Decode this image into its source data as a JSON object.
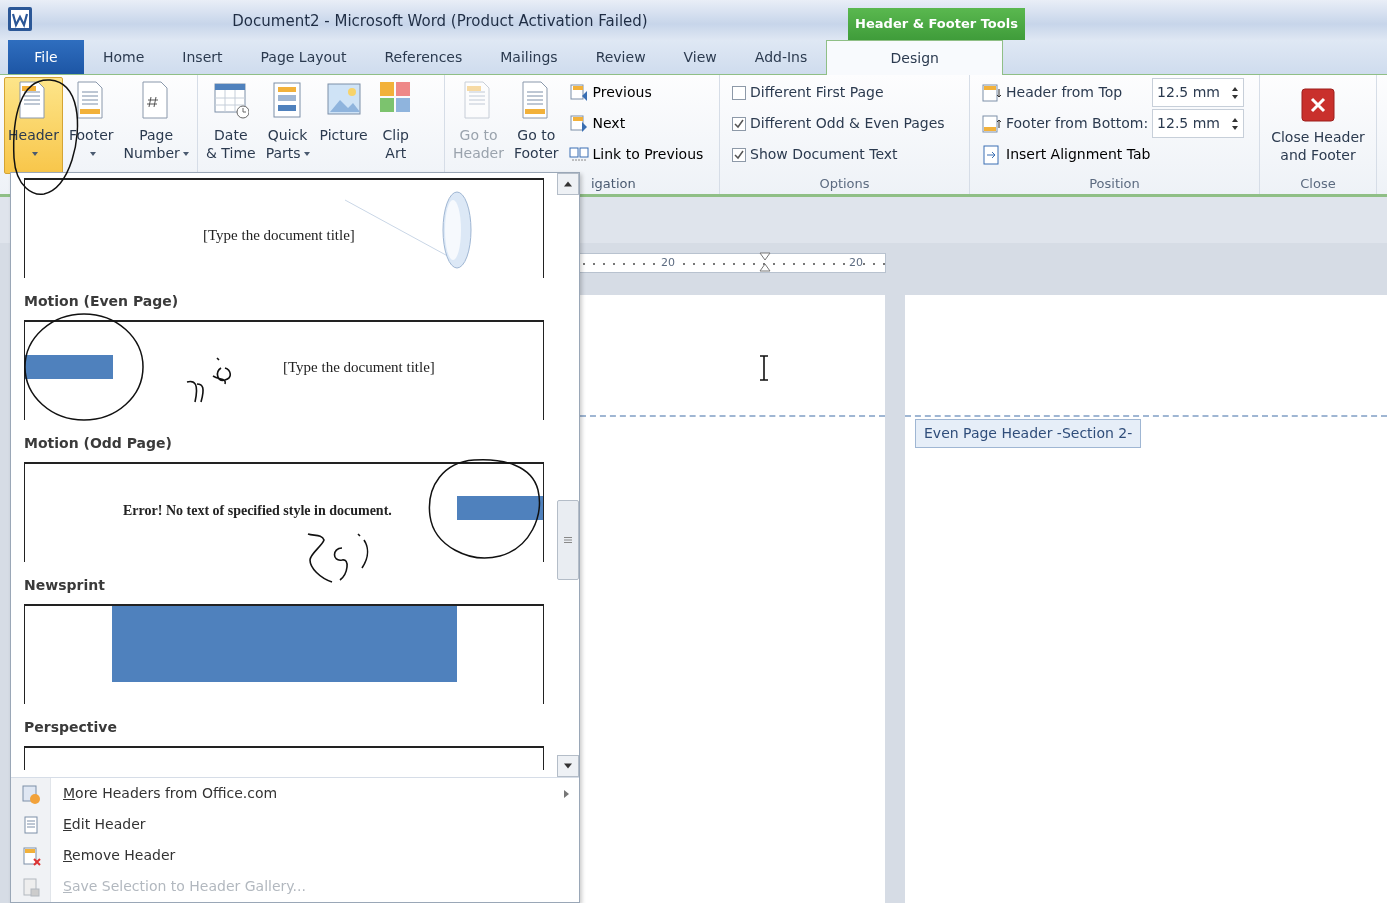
{
  "window": {
    "title": "Document2 - Microsoft Word (Product Activation Failed)",
    "context_title": "Header & Footer Tools"
  },
  "tabs": [
    {
      "label": "File",
      "kind": "file",
      "selected": false
    },
    {
      "label": "Home",
      "kind": "plain",
      "selected": false
    },
    {
      "label": "Insert",
      "kind": "plain",
      "selected": false
    },
    {
      "label": "Page Layout",
      "kind": "plain",
      "selected": false
    },
    {
      "label": "References",
      "kind": "plain",
      "selected": false
    },
    {
      "label": "Mailings",
      "kind": "plain",
      "selected": false
    },
    {
      "label": "Review",
      "kind": "plain",
      "selected": false
    },
    {
      "label": "View",
      "kind": "plain",
      "selected": false
    },
    {
      "label": "Add-Ins",
      "kind": "plain",
      "selected": false
    },
    {
      "label": "Design",
      "kind": "context",
      "selected": true
    }
  ],
  "ribbon": {
    "groups": [
      {
        "kind": "large",
        "controls": [
          {
            "label": "Header",
            "dropdown": true,
            "pressed": true,
            "disabled": false
          },
          {
            "label": "Footer",
            "dropdown": true,
            "pressed": false,
            "disabled": false
          },
          {
            "label": "Page\nNumber",
            "dropdown": true,
            "pressed": false,
            "disabled": false
          }
        ]
      },
      {
        "kind": "large",
        "controls": [
          {
            "label": "Date\n& Time",
            "dropdown": false,
            "pressed": false,
            "disabled": false
          },
          {
            "label": "Quick\nParts",
            "dropdown": true,
            "pressed": false,
            "disabled": false
          },
          {
            "label": "Picture",
            "dropdown": false,
            "pressed": false,
            "disabled": false
          },
          {
            "label": "Clip\nArt",
            "dropdown": false,
            "pressed": false,
            "disabled": false
          }
        ]
      },
      {
        "kind": "nav",
        "label": "igation",
        "controls": [
          {
            "label": "Go to\nHeader",
            "dropdown": false,
            "pressed": false,
            "disabled": true
          },
          {
            "label": "Go to\nFooter",
            "dropdown": false,
            "pressed": false,
            "disabled": false
          }
        ],
        "small": [
          {
            "label": "Previous"
          },
          {
            "label": "Next"
          },
          {
            "label": "Link to Previous"
          }
        ]
      },
      {
        "kind": "options",
        "label": "Options",
        "checks": [
          {
            "label": "Different First Page",
            "checked": false
          },
          {
            "label": "Different Odd & Even Pages",
            "checked": true
          },
          {
            "label": "Show Document Text",
            "checked": true
          }
        ]
      },
      {
        "kind": "position",
        "label": "Position",
        "spins": [
          {
            "label": "Header from Top",
            "value": "12.5 mm"
          },
          {
            "label": "Footer from Bottom:",
            "value": "12.5 mm"
          }
        ],
        "tab_button": "Insert Alignment Tab"
      },
      {
        "kind": "close",
        "label": "Close",
        "button": "Close Header\nand Footer"
      }
    ]
  },
  "gallery": {
    "items": [
      {
        "kind": "title-ornament",
        "preview_text": "[Type the document title]"
      },
      {
        "kind": "motion-even",
        "title": "Motion (Even Page)",
        "preview_text": "[Type the document title]"
      },
      {
        "kind": "motion-odd",
        "title": "Motion (Odd Page)",
        "preview_text": "Error! No text of specified style in document."
      },
      {
        "kind": "newsprint",
        "title": "Newsprint"
      },
      {
        "kind": "blank",
        "title": "Perspective"
      }
    ],
    "menu": [
      {
        "label": "More Headers from Office.com",
        "submenu": true,
        "disabled": false
      },
      {
        "label": "Edit Header",
        "submenu": false,
        "disabled": false
      },
      {
        "label": "Remove Header",
        "submenu": false,
        "disabled": false
      },
      {
        "label": "Save Selection to Header Gallery...",
        "submenu": false,
        "disabled": true
      }
    ]
  },
  "document": {
    "ruler_labels": [
      "20",
      "20"
    ],
    "header_tag": "Even Page Header -Section 2-"
  }
}
